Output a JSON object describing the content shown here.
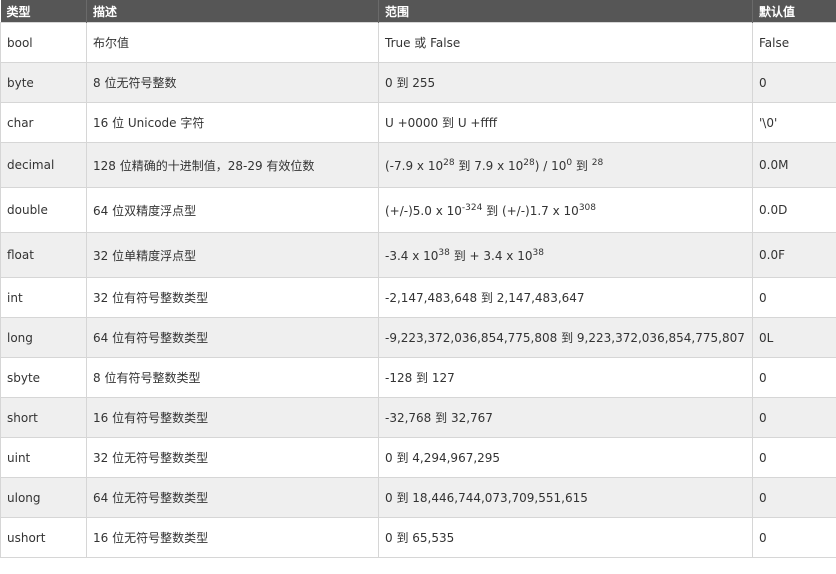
{
  "table": {
    "headers": [
      "类型",
      "描述",
      "范围",
      "默认值"
    ],
    "rows": [
      {
        "type": "bool",
        "desc": "布尔值",
        "range": "True 或 False",
        "default": "False"
      },
      {
        "type": "byte",
        "desc": "8 位无符号整数",
        "range": "0 到 255",
        "default": "0"
      },
      {
        "type": "char",
        "desc": "16 位 Unicode 字符",
        "range": "U +0000 到 U +ffff",
        "default": "'\\0'"
      },
      {
        "type": "decimal",
        "desc": "128 位精确的十进制值，28-29 有效位数",
        "range_parts": [
          "(-7.9 x 10",
          "28",
          " 到 7.9 x 10",
          "28",
          ") / 10",
          "0",
          " 到 ",
          "28"
        ],
        "default": "0.0M"
      },
      {
        "type": "double",
        "desc": "64 位双精度浮点型",
        "range_parts": [
          "(+/-)5.0 x 10",
          "-324",
          " 到 (+/-)1.7 x 10",
          "308"
        ],
        "default": "0.0D"
      },
      {
        "type": "float",
        "desc": "32 位单精度浮点型",
        "range_parts": [
          "-3.4 x 10",
          "38",
          " 到 + 3.4 x 10",
          "38"
        ],
        "default": "0.0F"
      },
      {
        "type": "int",
        "desc": "32 位有符号整数类型",
        "range": "-2,147,483,648 到 2,147,483,647",
        "default": "0"
      },
      {
        "type": "long",
        "desc": "64 位有符号整数类型",
        "range": "-9,223,372,036,854,775,808 到 9,223,372,036,854,775,807",
        "default": "0L"
      },
      {
        "type": "sbyte",
        "desc": "8 位有符号整数类型",
        "range": "-128 到 127",
        "default": "0"
      },
      {
        "type": "short",
        "desc": "16 位有符号整数类型",
        "range": "-32,768 到 32,767",
        "default": "0"
      },
      {
        "type": "uint",
        "desc": "32 位无符号整数类型",
        "range": "0 到 4,294,967,295",
        "default": "0"
      },
      {
        "type": "ulong",
        "desc": "64 位无符号整数类型",
        "range": "0 到 18,446,744,073,709,551,615",
        "default": "0"
      },
      {
        "type": "ushort",
        "desc": "16 位无符号整数类型",
        "range": "0 到 65,535",
        "default": "0"
      }
    ]
  }
}
